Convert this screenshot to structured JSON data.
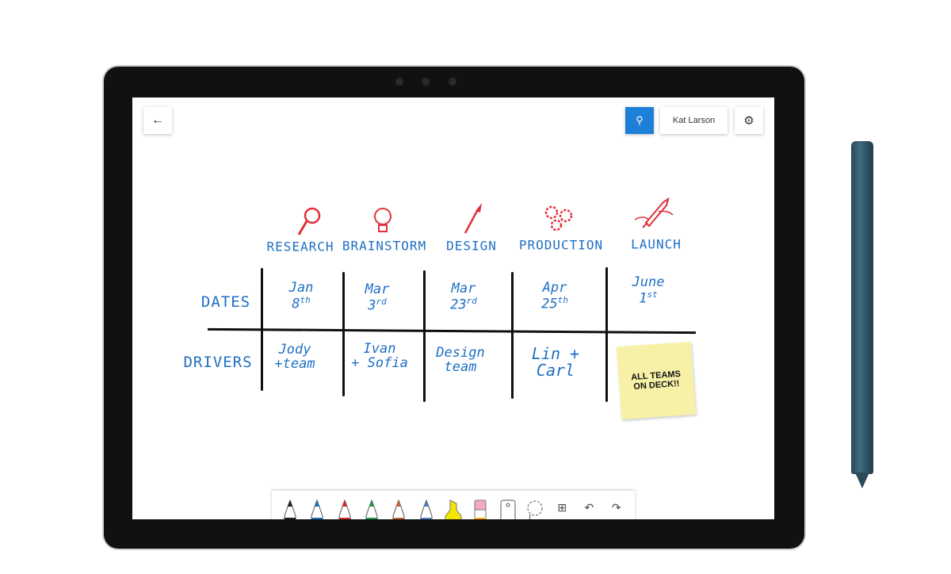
{
  "header": {
    "back_icon": "arrow-left-icon",
    "user_icon": "person-icon",
    "user_name": "Kat Larson",
    "settings_icon": "gear-icon",
    "accent": "#1e7fd8"
  },
  "board": {
    "columns": [
      {
        "label": "RESEARCH",
        "icon": "magnifier-icon"
      },
      {
        "label": "BRAINSTORM",
        "icon": "lightbulb-icon"
      },
      {
        "label": "DESIGN",
        "icon": "paintbrush-icon"
      },
      {
        "label": "PRODUCTION",
        "icon": "gears-icon"
      },
      {
        "label": "LAUNCH",
        "icon": "rocket-icon"
      }
    ],
    "rows": [
      "DATES",
      "DRIVERS"
    ],
    "dates": [
      {
        "month": "Jan",
        "day": "8",
        "suffix": "th"
      },
      {
        "month": "Mar",
        "day": "3",
        "suffix": "rd"
      },
      {
        "month": "Mar",
        "day": "23",
        "suffix": "rd"
      },
      {
        "month": "Apr",
        "day": "25",
        "suffix": "th"
      },
      {
        "month": "June",
        "day": "1",
        "suffix": "st"
      }
    ],
    "drivers": [
      {
        "l1": "Jody",
        "l2": "+team"
      },
      {
        "l1": "Ivan",
        "l2": "+ Sofia"
      },
      {
        "l1": "Design",
        "l2": "team"
      },
      {
        "l1": "Lin +",
        "l2": "Carl"
      }
    ],
    "sticky_note": "ALL TEAMS ON DECK!!",
    "ink_color": "#1e6fc4",
    "icon_color": "#e0303a"
  },
  "toolbar": {
    "tools": [
      "black-pen",
      "blue-pen",
      "red-pen",
      "green-pen",
      "rainbow-pen",
      "galaxy-pen",
      "highlighter",
      "eraser",
      "ruler",
      "lasso",
      "add",
      "undo",
      "redo"
    ],
    "pen_colors": [
      "#222222",
      "#1e6fc4",
      "#d9262e",
      "#1a9a4e",
      "#c8643a",
      "#4a7fc0",
      "#f2e600",
      "#f4a7c8"
    ]
  }
}
